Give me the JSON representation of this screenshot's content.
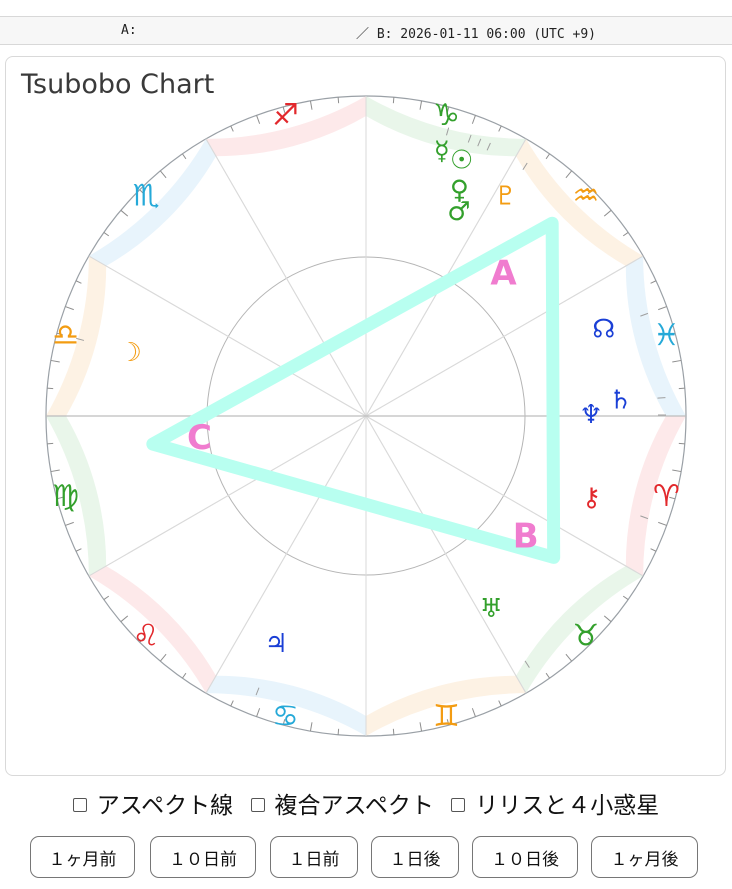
{
  "header": {
    "a_label": "A:",
    "b_label": "／ B: 2026-01-11 06:00 (UTC +9)"
  },
  "chart": {
    "title": "Tsubobo Chart",
    "asc_degree": 180,
    "signs": [
      {
        "glyph": "♈",
        "name": "aries-glyph",
        "color": "#e2282c",
        "band": "#fde9ea"
      },
      {
        "glyph": "♉",
        "name": "taurus-glyph",
        "color": "#33a02c",
        "band": "#e9f6ea"
      },
      {
        "glyph": "♊",
        "name": "gemini-glyph",
        "color": "#f39c12",
        "band": "#fdf2e4"
      },
      {
        "glyph": "♋",
        "name": "cancer-glyph",
        "color": "#25a9d8",
        "band": "#e8f4fc"
      },
      {
        "glyph": "♌",
        "name": "leo-glyph",
        "color": "#e2282c",
        "band": "#fde9ea"
      },
      {
        "glyph": "♍",
        "name": "virgo-glyph",
        "color": "#33a02c",
        "band": "#e9f6ea"
      },
      {
        "glyph": "♎",
        "name": "libra-glyph",
        "color": "#f39c12",
        "band": "#fdf2e4"
      },
      {
        "glyph": "♏",
        "name": "scorpio-glyph",
        "color": "#25a9d8",
        "band": "#e8f4fc"
      },
      {
        "glyph": "♐",
        "name": "sagittarius-glyph",
        "color": "#e2282c",
        "band": "#fde9ea"
      },
      {
        "glyph": "♑",
        "name": "capricorn-glyph",
        "color": "#33a02c",
        "band": "#e9f6ea"
      },
      {
        "glyph": "♒",
        "name": "aquarius-glyph",
        "color": "#f39c12",
        "band": "#fdf2e4"
      },
      {
        "glyph": "♓",
        "name": "pisces-glyph",
        "color": "#25a9d8",
        "band": "#e8f4fc"
      }
    ],
    "planets": [
      {
        "name": "sun",
        "glyph": "☉",
        "lon": 290.5,
        "color": "#33a02c"
      },
      {
        "name": "mercury",
        "glyph": "☿",
        "lon": 286.0,
        "color": "#33a02c"
      },
      {
        "name": "venus",
        "glyph": "♀",
        "lon": 292.5,
        "color": "#33a02c"
      },
      {
        "name": "mars",
        "glyph": "♂",
        "lon": 294.5,
        "color": "#33a02c"
      },
      {
        "name": "moon",
        "glyph": "☽",
        "lon": 195.0,
        "color": "#f39c12"
      },
      {
        "name": "jupiter",
        "glyph": "♃",
        "lon": 111.5,
        "color": "#1a3fd6"
      },
      {
        "name": "saturn",
        "glyph": "♄",
        "lon": 356.5,
        "color": "#1a3fd6"
      },
      {
        "name": "uranus",
        "glyph": "♅",
        "lon": 57.0,
        "color": "#33a02c"
      },
      {
        "name": "neptune",
        "glyph": "♆",
        "lon": 359.8,
        "color": "#1a3fd6"
      },
      {
        "name": "pluto",
        "glyph": "♇",
        "lon": 302.5,
        "color": "#f39c12"
      },
      {
        "name": "node",
        "glyph": "☊",
        "lon": 340.0,
        "color": "#1a3fd6"
      },
      {
        "name": "chiron",
        "glyph": "⚷",
        "lon": 20.0,
        "color": "#e2282c"
      }
    ],
    "pattern_points": [
      {
        "label": "A",
        "lon": 314.0
      },
      {
        "label": "B",
        "lon": 37.0
      },
      {
        "label": "C",
        "lon": 172.5
      }
    ],
    "pattern_color": "#b8fff0",
    "point_label_color": "#f07ccf"
  },
  "options": [
    {
      "label": "アスペクト線",
      "name": "aspect-lines-checkbox"
    },
    {
      "label": "複合アスペクト",
      "name": "composite-aspect-checkbox"
    },
    {
      "label": "リリスと４小惑星",
      "name": "lilith-asteroids-checkbox"
    }
  ],
  "buttons": [
    {
      "label": "１ヶ月前",
      "name": "one-month-before-button"
    },
    {
      "label": "１０日前",
      "name": "ten-days-before-button"
    },
    {
      "label": "１日前",
      "name": "one-day-before-button"
    },
    {
      "label": "１日後",
      "name": "one-day-after-button"
    },
    {
      "label": "１０日後",
      "name": "ten-days-after-button"
    },
    {
      "label": "１ヶ月後",
      "name": "one-month-after-button"
    }
  ]
}
